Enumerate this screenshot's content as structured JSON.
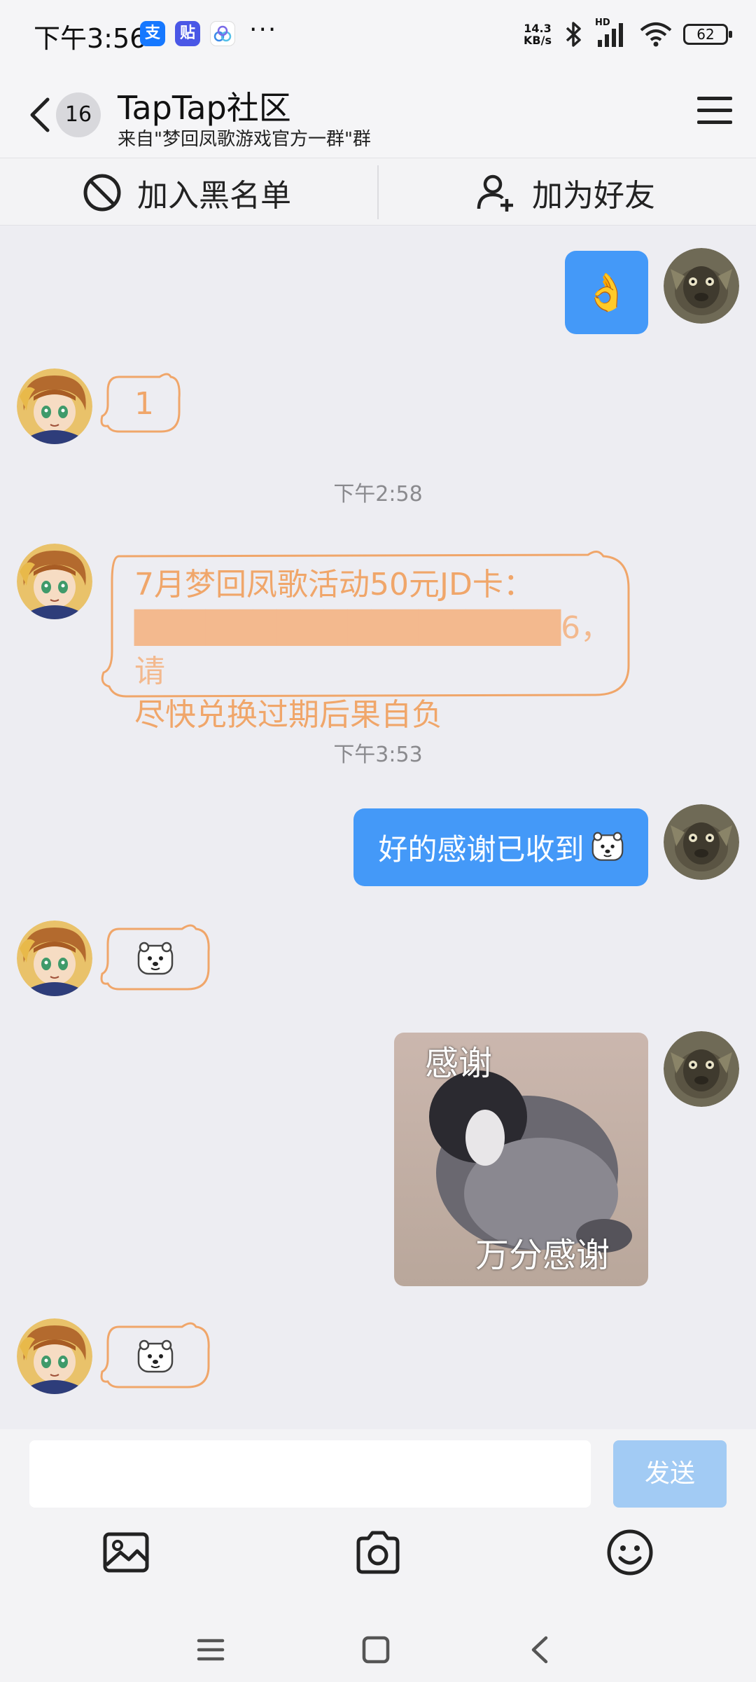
{
  "status_bar": {
    "time": "下午3:56",
    "apps": [
      "支",
      "贴"
    ],
    "more": "···",
    "net_speed_value": "14.3",
    "net_speed_unit": "KB/s",
    "hd": "HD",
    "battery": "62"
  },
  "header": {
    "back_badge": "16",
    "title": "TapTap社区",
    "subtitle": "来自\"梦回凤歌游戏官方一群\"群"
  },
  "action_bar": {
    "block_label": "加入黑名单",
    "add_friend_label": "加为好友"
  },
  "chat": {
    "messages": [
      {
        "from": "self",
        "type": "emoji",
        "content": "👌"
      },
      {
        "from": "other",
        "type": "text",
        "content": "1"
      },
      {
        "type": "time",
        "content": "下午2:58"
      },
      {
        "from": "other",
        "type": "text",
        "content_lines": [
          "7月梦回凤歌活动50元JD卡：",
          "██████████████████6，请",
          "尽快兑换过期后果自负"
        ]
      },
      {
        "type": "time",
        "content": "下午3:53"
      },
      {
        "from": "self",
        "type": "text",
        "content": "好的感谢已收到"
      },
      {
        "from": "other",
        "type": "sticker",
        "icon": "bear-emoji"
      },
      {
        "from": "self",
        "type": "image",
        "caption_top": "感谢",
        "caption_bottom": "万分感谢"
      },
      {
        "from": "other",
        "type": "sticker",
        "icon": "bear-emoji"
      }
    ]
  },
  "input": {
    "value": "",
    "send_label": "发送"
  },
  "toolbar": {
    "icons": [
      "image-icon",
      "camera-icon",
      "emoji-icon"
    ]
  },
  "colors": {
    "self_bubble": "#4499f8",
    "other_bubble_outline": "#f0a66a",
    "send_disabled": "#a2cbf4"
  }
}
